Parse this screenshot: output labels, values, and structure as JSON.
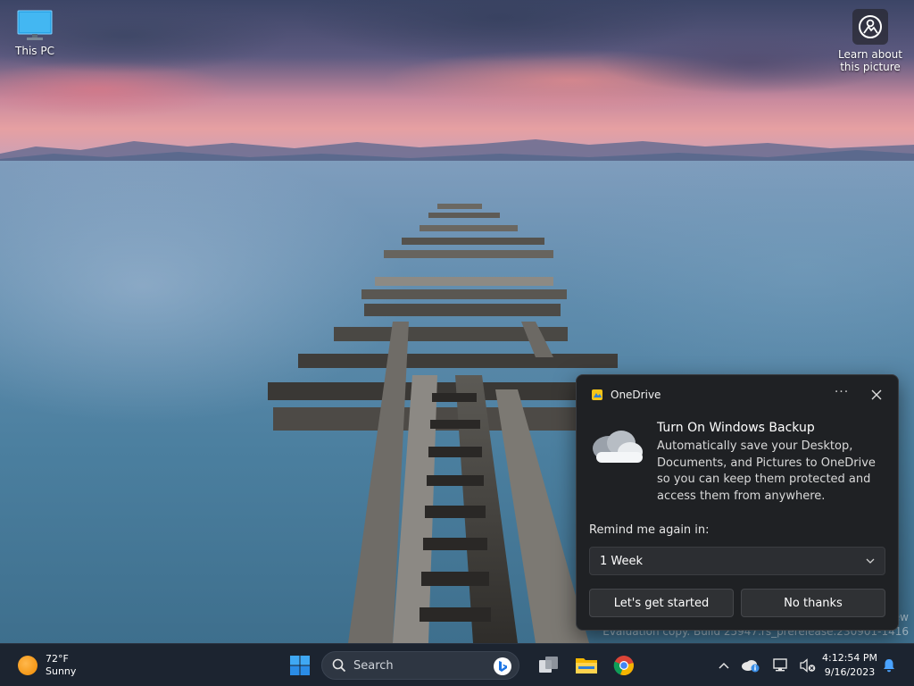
{
  "desktop": {
    "icons": [
      {
        "label": "This PC",
        "icon": "computer-icon"
      },
      {
        "label": "Learn about this picture",
        "icon": "camera-info-icon"
      }
    ],
    "watermark": {
      "line1": "ew",
      "line2": "Evaluation copy. Build 25947.rs_prerelease.230901-1416"
    }
  },
  "toast": {
    "app_name": "OneDrive",
    "more_label": "···",
    "title": "Turn On Windows Backup",
    "body": "Automatically save your Desktop, Documents, and Pictures to OneDrive so you can keep them protected and access them from anywhere.",
    "remind_label": "Remind me again in:",
    "remind_value": "1 Week",
    "primary_button": "Let's get started",
    "secondary_button": "No thanks"
  },
  "taskbar": {
    "weather": {
      "temp": "72°F",
      "condition": "Sunny"
    },
    "search_placeholder": "Search",
    "pinned_apps": [
      "task-view-icon",
      "file-explorer-icon",
      "chrome-icon"
    ],
    "clock": {
      "time": "4:12:54 PM",
      "date": "9/16/2023"
    }
  },
  "colors": {
    "toast_bg": "#1f2124",
    "taskbar_bg": "#1c2430",
    "accent_blue": "#3a8ee6",
    "bell_blue": "#4aa3ff"
  }
}
